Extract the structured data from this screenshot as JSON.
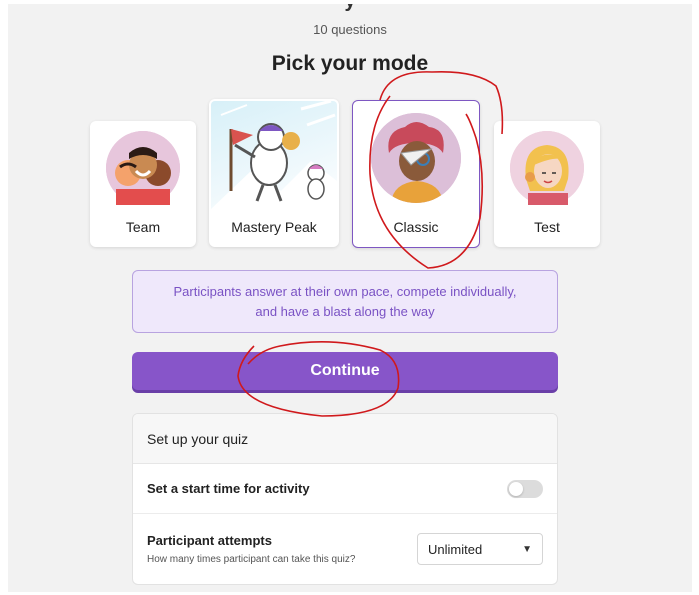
{
  "quiz": {
    "title_partial": "y",
    "question_count": "10 questions"
  },
  "mode_picker": {
    "heading": "Pick your mode",
    "selected": "Classic",
    "modes": [
      {
        "label": "Team",
        "icon": "team-avatar-icon"
      },
      {
        "label": "Mastery Peak",
        "icon": "mastery-peak-illustration"
      },
      {
        "label": "Classic",
        "icon": "classic-avatar-icon"
      },
      {
        "label": "Test",
        "icon": "test-avatar-icon"
      }
    ],
    "description": "Participants answer at their own pace, compete individually, and have a blast along the way"
  },
  "actions": {
    "continue_label": "Continue"
  },
  "setup": {
    "title": "Set up your quiz",
    "start_time_label": "Set a start time for activity",
    "start_time_enabled": false,
    "attempts_label": "Participant attempts",
    "attempts_help": "How many times participant can take this quiz?",
    "attempts_value": "Unlimited"
  },
  "colors": {
    "primary": "#8755c9",
    "desc_bg": "#efe8fb",
    "desc_text": "#7a52c4",
    "annotation": "#d0191c"
  }
}
